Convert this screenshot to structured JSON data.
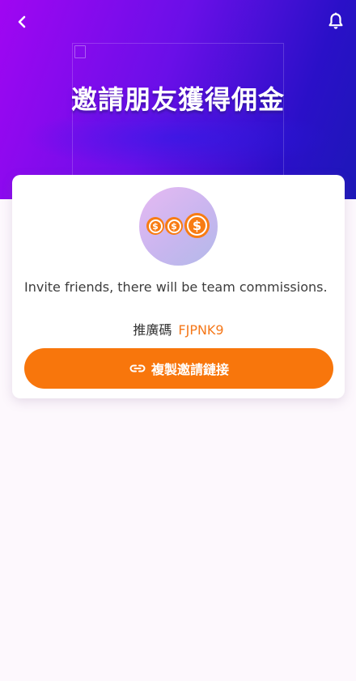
{
  "header": {
    "title": "邀請朋友獲得佣金",
    "back_icon": "chevron-left-icon",
    "notification_icon": "bell-icon"
  },
  "card": {
    "illustration_icon": "dollar-coins-icon",
    "coin_symbol": "$",
    "description": "Invite friends, there will be team commissions.",
    "promo_label": "推廣碼",
    "promo_code": "FJPNK9",
    "copy_button_label": "複製邀請鏈接",
    "copy_button_icon": "link-icon"
  },
  "colors": {
    "accent": "#f8760c",
    "promo_code": "#f5781a",
    "hero_start": "#a006f2",
    "hero_end": "#1d18b8"
  }
}
